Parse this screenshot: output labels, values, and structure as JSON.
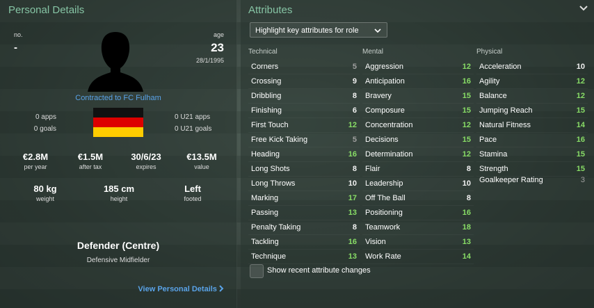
{
  "left": {
    "title": "Personal Details",
    "no_label": "no.",
    "no_value": "-",
    "age_label": "age",
    "age_value": "23",
    "dob": "28/1/1995",
    "contract": "Contracted to FC Fulham",
    "apps_left": "0 apps",
    "goals_left": "0 goals",
    "apps_right": "0 U21 apps",
    "goals_right": "0 U21 goals",
    "money": [
      {
        "value": "€2.8M",
        "label": "per year"
      },
      {
        "value": "€1.5M",
        "label": "after tax"
      },
      {
        "value": "30/6/23",
        "label": "expires"
      },
      {
        "value": "€13.5M",
        "label": "value"
      }
    ],
    "physical": [
      {
        "value": "80 kg",
        "label": "weight"
      },
      {
        "value": "185 cm",
        "label": "height"
      },
      {
        "value": "Left",
        "label": "footed"
      }
    ],
    "position_main": "Defender (Centre)",
    "position_sub": "Defensive Midfielder",
    "view_link": "View Personal Details",
    "flag_colors": [
      "#111111",
      "#dd0000",
      "#ffcc00"
    ]
  },
  "right": {
    "title": "Attributes",
    "highlight": "Highlight key attributes for role",
    "technical_head": "Technical",
    "mental_head": "Mental",
    "physical_head": "Physical",
    "technical": [
      {
        "name": "Corners",
        "value": "5"
      },
      {
        "name": "Crossing",
        "value": "9"
      },
      {
        "name": "Dribbling",
        "value": "8"
      },
      {
        "name": "Finishing",
        "value": "6"
      },
      {
        "name": "First Touch",
        "value": "12"
      },
      {
        "name": "Free Kick Taking",
        "value": "5"
      },
      {
        "name": "Heading",
        "value": "16"
      },
      {
        "name": "Long Shots",
        "value": "8"
      },
      {
        "name": "Long Throws",
        "value": "10"
      },
      {
        "name": "Marking",
        "value": "17"
      },
      {
        "name": "Passing",
        "value": "13"
      },
      {
        "name": "Penalty Taking",
        "value": "8"
      },
      {
        "name": "Tackling",
        "value": "16"
      },
      {
        "name": "Technique",
        "value": "13"
      }
    ],
    "mental": [
      {
        "name": "Aggression",
        "value": "12"
      },
      {
        "name": "Anticipation",
        "value": "16"
      },
      {
        "name": "Bravery",
        "value": "15"
      },
      {
        "name": "Composure",
        "value": "15"
      },
      {
        "name": "Concentration",
        "value": "12"
      },
      {
        "name": "Decisions",
        "value": "15"
      },
      {
        "name": "Determination",
        "value": "12"
      },
      {
        "name": "Flair",
        "value": "8"
      },
      {
        "name": "Leadership",
        "value": "10"
      },
      {
        "name": "Off The Ball",
        "value": "8"
      },
      {
        "name": "Positioning",
        "value": "16"
      },
      {
        "name": "Teamwork",
        "value": "18"
      },
      {
        "name": "Vision",
        "value": "13"
      },
      {
        "name": "Work Rate",
        "value": "14"
      }
    ],
    "physical": [
      {
        "name": "Acceleration",
        "value": "10"
      },
      {
        "name": "Agility",
        "value": "12"
      },
      {
        "name": "Balance",
        "value": "12"
      },
      {
        "name": "Jumping Reach",
        "value": "15"
      },
      {
        "name": "Natural Fitness",
        "value": "14"
      },
      {
        "name": "Pace",
        "value": "16"
      },
      {
        "name": "Stamina",
        "value": "15"
      },
      {
        "name": "Strength",
        "value": "15"
      }
    ],
    "gk_label": "Goalkeeper Rating",
    "gk_value": "3",
    "checkbox_label": "Show recent attribute changes"
  }
}
